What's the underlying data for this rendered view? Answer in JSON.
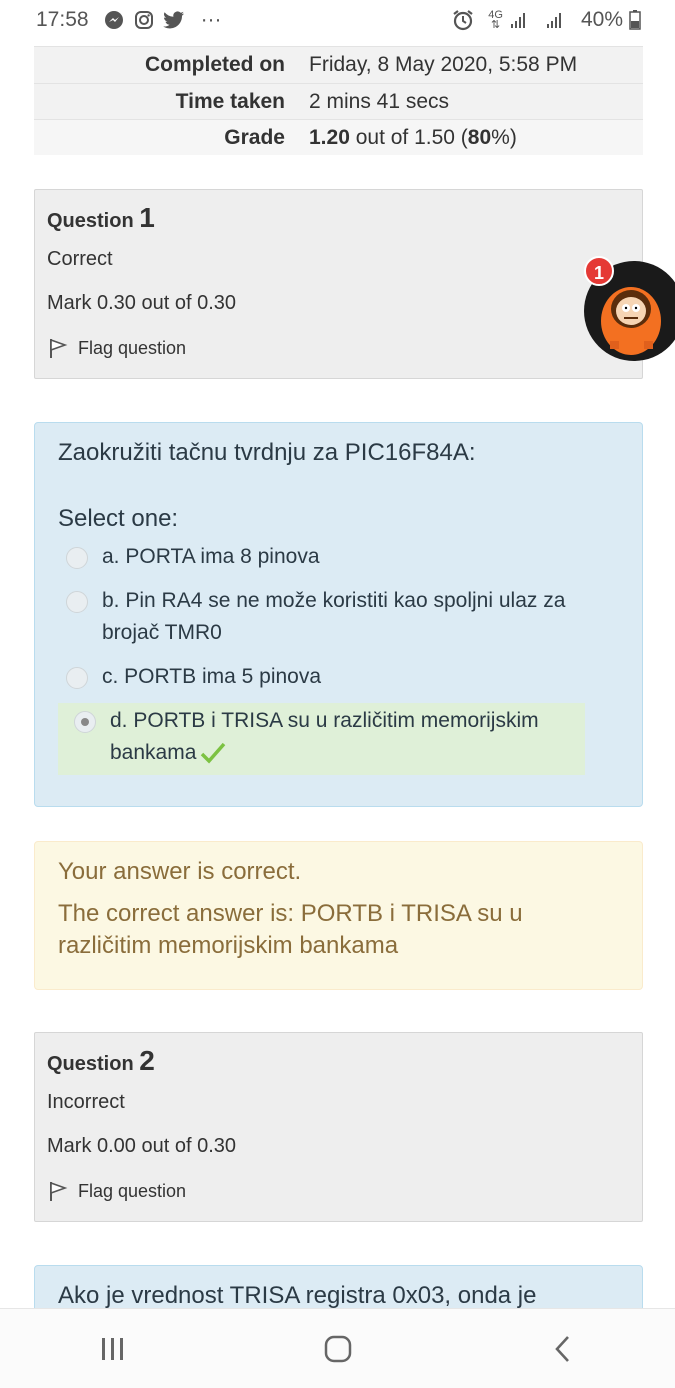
{
  "status_bar": {
    "time": "17:58",
    "more": "···",
    "network": "4G",
    "battery": "40%"
  },
  "summary": {
    "rows": [
      {
        "label": "Completed on",
        "value": "Friday, 8 May 2020, 5:58 PM"
      },
      {
        "label": "Time taken",
        "value": "2 mins 41 secs"
      }
    ],
    "grade_label": "Grade",
    "grade_value": "1.20",
    "grade_middle": " out of 1.50 (",
    "grade_percent": "80",
    "grade_suffix": "%)"
  },
  "question1": {
    "prefix": "Question",
    "number": "1",
    "state": "Correct",
    "mark": "Mark 0.30 out of 0.30",
    "flag_label": "Flag question",
    "prompt": "Zaokružiti tačnu tvrdnju za PIC16F84A:",
    "select_label": "Select one:",
    "answers": [
      {
        "text": "a. PORTA ima 8 pinova"
      },
      {
        "text": "b. Pin RA4 se ne može koristiti kao spoljni ulaz za brojač TMR0"
      },
      {
        "text": "c. PORTB ima 5 pinova"
      },
      {
        "text": "d. PORTB i TRISA su u različitim memorijskim bankama"
      }
    ],
    "feedback1": "Your answer is correct.",
    "feedback2": "The correct answer is: PORTB i TRISA su u različitim memorijskim bankama"
  },
  "question2": {
    "prefix": "Question",
    "number": "2",
    "state": "Incorrect",
    "mark": "Mark 0.00 out of 0.30",
    "flag_label": "Flag question",
    "prompt": "Ako je vrednost TRISA registra 0x03, onda je"
  },
  "chat_head": {
    "badge_count": "1"
  },
  "colors": {
    "info_bg": "#eeeeee",
    "qtext_bg": "#dcebf4",
    "correct_bg": "#dff0d8",
    "feedback_bg": "#fcf8e3",
    "feedback_text": "#8a6d3b",
    "check_green": "#7cc242",
    "badge_red": "#e53935"
  }
}
